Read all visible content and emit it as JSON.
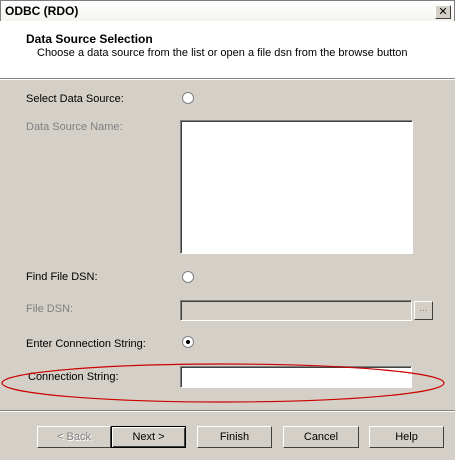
{
  "window": {
    "title": "ODBC (RDO)",
    "close_glyph": "✕"
  },
  "header": {
    "title": "Data Source Selection",
    "subtitle": "Choose a data source from the list or open a file dsn from the browse button"
  },
  "form": {
    "select_data_source_label": "Select Data Source:",
    "select_data_source_selected": false,
    "data_source_name_label": "Data Source Name:",
    "find_file_dsn_label": "Find File DSN:",
    "find_file_dsn_selected": false,
    "file_dsn_label": "File DSN:",
    "file_dsn_value": "",
    "browse_label": "...",
    "enter_connection_string_label": "Enter Connection String:",
    "enter_connection_string_selected": true,
    "connection_string_label": "Connection String:",
    "connection_string_value": ""
  },
  "buttons": {
    "back": "< Back",
    "next": "Next >",
    "finish": "Finish",
    "cancel": "Cancel",
    "help": "Help"
  },
  "colors": {
    "dialog_bg": "#d4d0c8",
    "annotation_ellipse": "#cc0000"
  },
  "icons": {
    "close": "close-icon",
    "radio_on": "radio-selected-icon",
    "radio_off": "radio-unselected-icon"
  }
}
